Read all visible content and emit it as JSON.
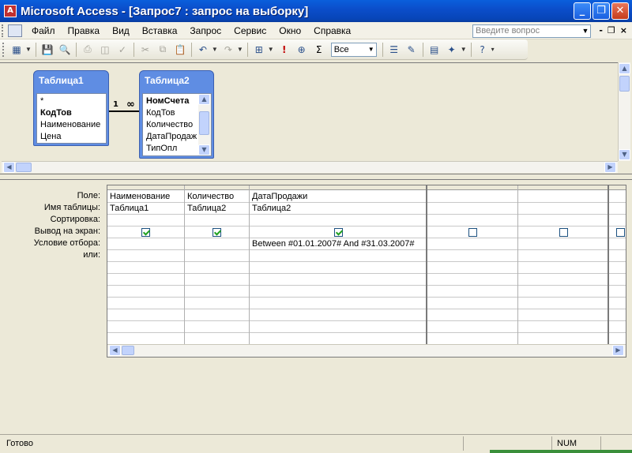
{
  "window": {
    "title": "Microsoft Access - [Запрос7 : запрос на выборку]",
    "controls": [
      "_",
      "❐",
      "✕"
    ]
  },
  "menu": {
    "items": [
      "Файл",
      "Правка",
      "Вид",
      "Вставка",
      "Запрос",
      "Сервис",
      "Окно",
      "Справка"
    ],
    "ask_placeholder": "Введите вопрос",
    "mdi_controls": [
      "-",
      "❐",
      "×"
    ]
  },
  "toolbar": {
    "top_values": "Все",
    "icons": [
      "datasheet-view-icon",
      "save-icon",
      "search-icon",
      "print-icon",
      "print-preview-icon",
      "spelling-icon",
      "cut-icon",
      "copy-icon",
      "paste-icon",
      "undo-icon",
      "redo-icon",
      "query-type-icon",
      "run-icon",
      "show-table-icon",
      "totals-icon",
      "properties-icon",
      "build-icon",
      "database-window-icon",
      "new-object-icon",
      "help-icon"
    ]
  },
  "tables": [
    {
      "name": "Таблица1",
      "fields": [
        {
          "label": "*",
          "bold": false
        },
        {
          "label": "КодТов",
          "bold": true
        },
        {
          "label": "Наименование",
          "bold": false
        },
        {
          "label": "Цена",
          "bold": false
        }
      ]
    },
    {
      "name": "Таблица2",
      "fields": [
        {
          "label": "НомСчета",
          "bold": true
        },
        {
          "label": "КодТов",
          "bold": false
        },
        {
          "label": "Количество",
          "bold": false
        },
        {
          "label": "ДатаПродаж",
          "bold": false
        },
        {
          "label": "ТипОпл",
          "bold": false
        }
      ]
    }
  ],
  "join": {
    "left_label": "1",
    "right_label": "∞"
  },
  "grid": {
    "row_labels": [
      "Поле:",
      "Имя таблицы:",
      "Сортировка:",
      "Вывод на экран:",
      "Условие отбора:",
      "или:"
    ],
    "columns": [
      {
        "field": "Наименование",
        "table": "Таблица1",
        "sort": "",
        "show": true,
        "criteria": "",
        "or": ""
      },
      {
        "field": "Количество",
        "table": "Таблица2",
        "sort": "",
        "show": true,
        "criteria": "",
        "or": ""
      },
      {
        "field": "ДатаПродажи",
        "table": "Таблица2",
        "sort": "",
        "show": true,
        "criteria": "Between #01.01.2007# And #31.03.2007#",
        "or": ""
      },
      {
        "field": "",
        "table": "",
        "sort": "",
        "show": false,
        "criteria": "",
        "or": ""
      },
      {
        "field": "",
        "table": "",
        "sort": "",
        "show": false,
        "criteria": "",
        "or": ""
      },
      {
        "field": "",
        "table": "",
        "sort": "",
        "show": false,
        "criteria": "",
        "or": ""
      }
    ]
  },
  "status": {
    "text": "Готово",
    "num": "NUM"
  }
}
